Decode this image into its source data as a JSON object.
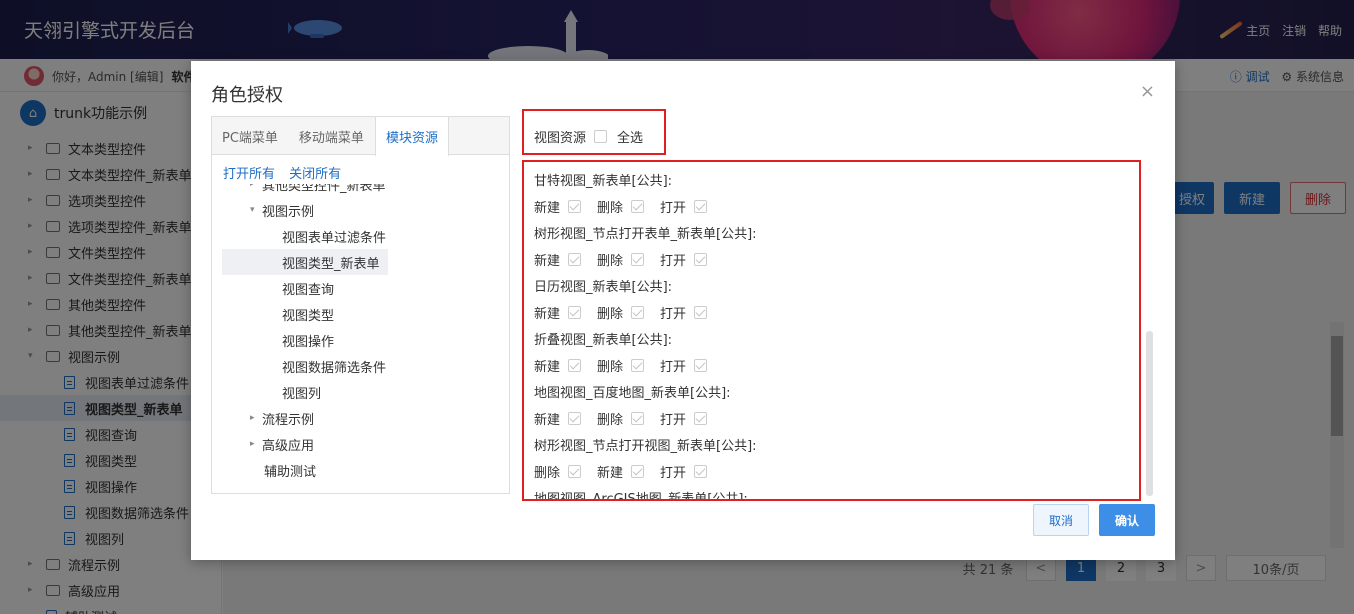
{
  "app": {
    "title": "天翎引擎式开发后台",
    "top_links": [
      "主页",
      "注销",
      "帮助"
    ],
    "greeting": "你好，Admin [编辑]",
    "software_label": "软件",
    "debug_label": "ⓘ 调试",
    "system_info_label": "⚙ 系统信息"
  },
  "sidebar": {
    "root": "trunk功能示例",
    "items": [
      {
        "label": "文本类型控件",
        "kind": "folder"
      },
      {
        "label": "文本类型控件_新表单",
        "kind": "folder"
      },
      {
        "label": "选项类型控件",
        "kind": "folder"
      },
      {
        "label": "选项类型控件_新表单",
        "kind": "folder"
      },
      {
        "label": "文件类型控件",
        "kind": "folder"
      },
      {
        "label": "文件类型控件_新表单",
        "kind": "folder"
      },
      {
        "label": "其他类型控件",
        "kind": "folder"
      },
      {
        "label": "其他类型控件_新表单",
        "kind": "folder"
      },
      {
        "label": "视图示例",
        "kind": "folder-open"
      },
      {
        "label": "视图表单过滤条件",
        "kind": "doc"
      },
      {
        "label": "视图类型_新表单",
        "kind": "doc",
        "active": true
      },
      {
        "label": "视图查询",
        "kind": "doc"
      },
      {
        "label": "视图类型",
        "kind": "doc"
      },
      {
        "label": "视图操作",
        "kind": "doc"
      },
      {
        "label": "视图数据筛选条件",
        "kind": "doc"
      },
      {
        "label": "视图列",
        "kind": "doc"
      },
      {
        "label": "流程示例",
        "kind": "folder"
      },
      {
        "label": "高级应用",
        "kind": "folder"
      },
      {
        "label": "辅助测试",
        "kind": "doc"
      }
    ]
  },
  "background": {
    "buttons": {
      "auth": "授权",
      "new": "新建",
      "delete": "删除"
    },
    "pager": {
      "total": "共 21 条",
      "prev": "<",
      "pages": [
        "1",
        "2",
        "3"
      ],
      "next": ">",
      "page_size": "10条/页"
    }
  },
  "modal": {
    "title": "角色授权",
    "close": "×",
    "tabs": [
      "PC端菜单",
      "移动端菜单",
      "模块资源"
    ],
    "active_tab": 2,
    "tree_actions": {
      "open_all": "打开所有",
      "close_all": "关闭所有"
    },
    "tree_nodes": [
      {
        "label": "其他类型控件_新表单",
        "caret": "▸"
      },
      {
        "label": "视图示例",
        "caret": "▾"
      },
      {
        "label": "视图表单过滤条件",
        "caret": ""
      },
      {
        "label": "视图类型_新表单",
        "caret": "",
        "selected": true
      },
      {
        "label": "视图查询",
        "caret": ""
      },
      {
        "label": "视图类型",
        "caret": ""
      },
      {
        "label": "视图操作",
        "caret": ""
      },
      {
        "label": "视图数据筛选条件",
        "caret": ""
      },
      {
        "label": "视图列",
        "caret": ""
      },
      {
        "label": "流程示例",
        "caret": "▸"
      },
      {
        "label": "高级应用",
        "caret": "▸"
      },
      {
        "label": "辅助测试",
        "caret": ""
      }
    ],
    "view_resources": {
      "label": "视图资源",
      "select_all": "全选",
      "select_all_checked": false
    },
    "permissions": [
      {
        "title": "甘特视图_新表单[公共]:",
        "actions": [
          "新建",
          "删除",
          "打开"
        ]
      },
      {
        "title": "树形视图_节点打开表单_新表单[公共]:",
        "actions": [
          "新建",
          "删除",
          "打开"
        ]
      },
      {
        "title": "日历视图_新表单[公共]:",
        "actions": [
          "新建",
          "删除",
          "打开"
        ]
      },
      {
        "title": "折叠视图_新表单[公共]:",
        "actions": [
          "新建",
          "删除",
          "打开"
        ]
      },
      {
        "title": "地图视图_百度地图_新表单[公共]:",
        "actions": [
          "新建",
          "删除",
          "打开"
        ]
      },
      {
        "title": "树形视图_节点打开视图_新表单[公共]:",
        "actions": [
          "删除",
          "新建",
          "打开"
        ]
      },
      {
        "title": "地图视图_ArcGIS地图_新表单[公共]:",
        "actions": []
      }
    ],
    "cancel_label": "取消",
    "confirm_label": "确认"
  },
  "colors": {
    "accent": "#1e6ec8",
    "highlight_border": "#e02020",
    "confirm_bg": "#3d8ee6"
  }
}
